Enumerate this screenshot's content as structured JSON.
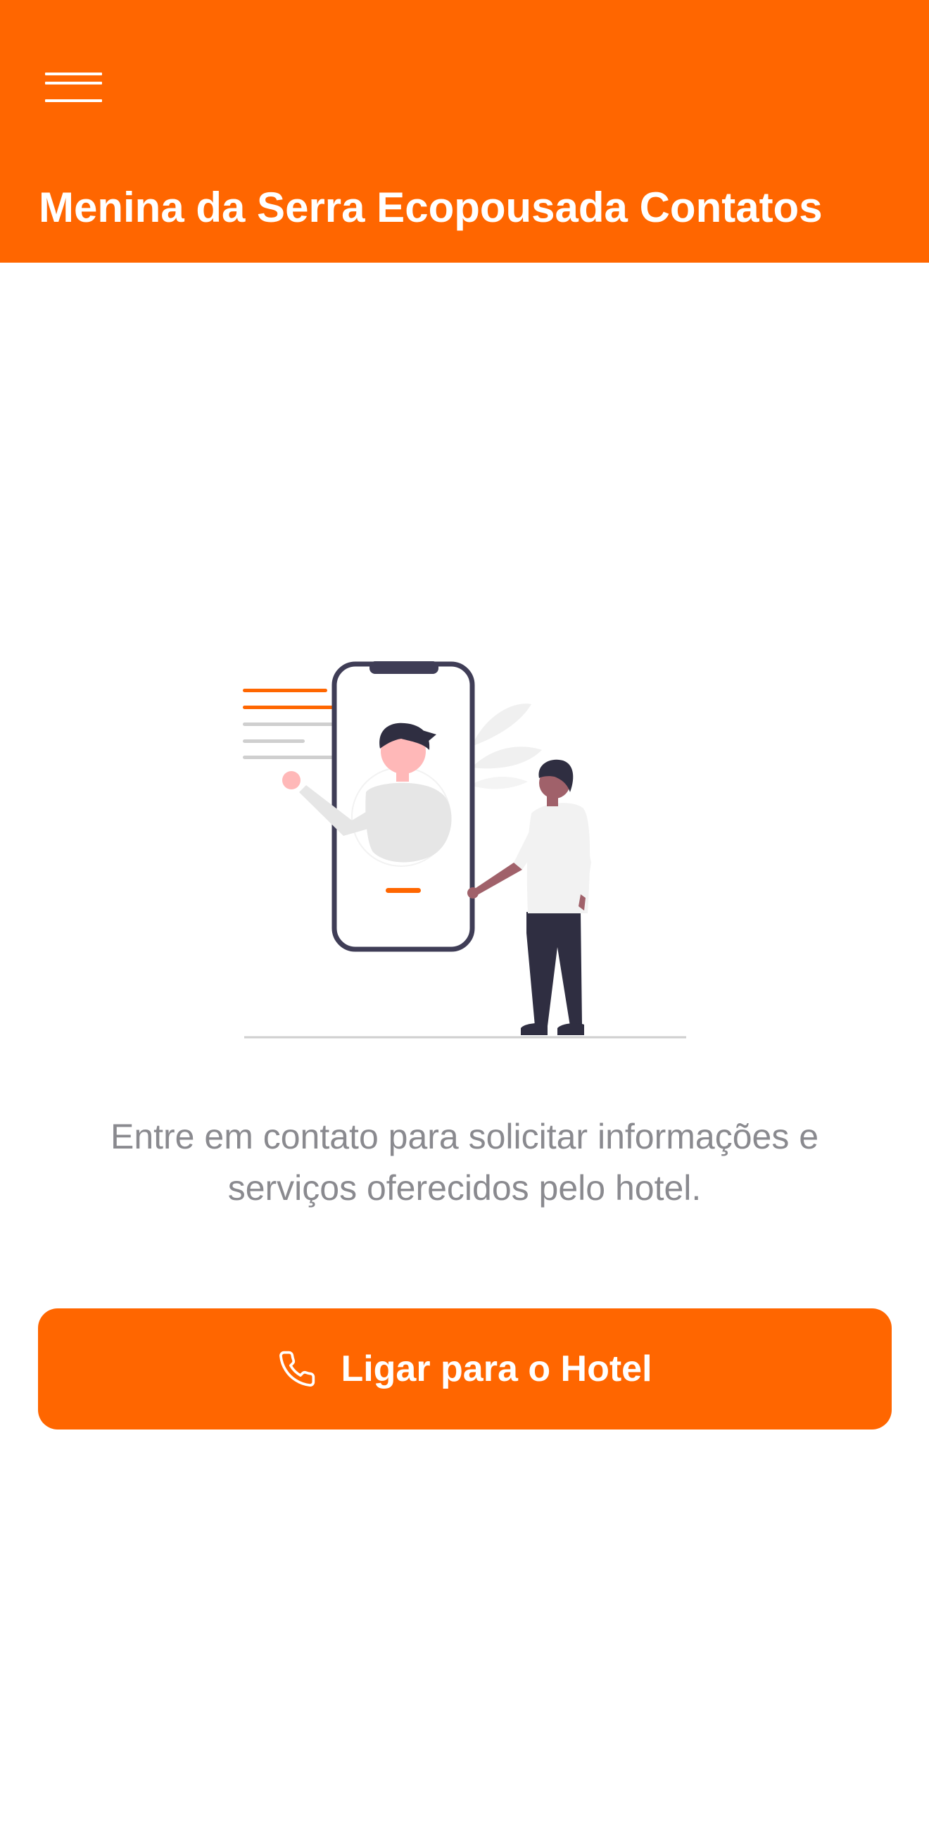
{
  "header": {
    "menu_icon": "hamburger-menu-icon",
    "title": "Menina da Serra Ecopousada Contatos",
    "background_color": "#ff6600"
  },
  "illustration": {
    "description_icon": "contact-phone-illustration"
  },
  "main": {
    "description": "Entre em contato para solicitar informações e serviços oferecidos pelo hotel."
  },
  "call_button": {
    "icon": "phone-icon",
    "label": "Ligar para o Hotel",
    "background_color": "#ff6600"
  },
  "colors": {
    "accent": "#ff6600",
    "text_secondary": "#8a8a8f",
    "illustration_dark": "#3f3d56",
    "illustration_light": "#e6e6e6"
  }
}
